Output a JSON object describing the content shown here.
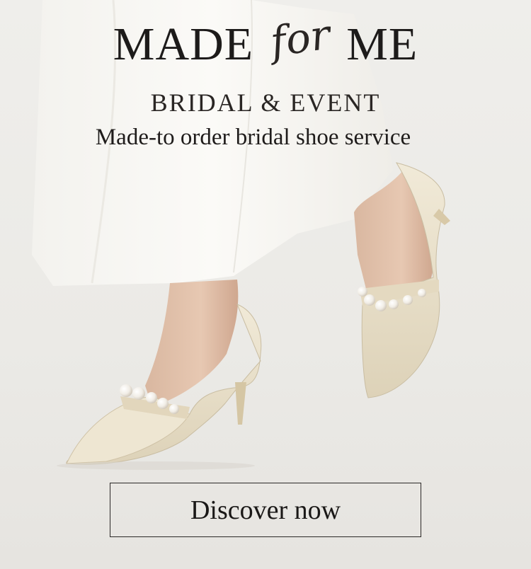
{
  "headline": {
    "part1": "MADE",
    "script": "for",
    "part2": "ME"
  },
  "subhead": "BRIDAL & EVENT",
  "tagline": "Made-to order bridal shoe service",
  "cta": {
    "label": "Discover now"
  },
  "colors": {
    "background": "#ecebe8",
    "dress": "#f8f7f4",
    "shoe": "#e9e1cc",
    "text": "#1f1c1b"
  }
}
